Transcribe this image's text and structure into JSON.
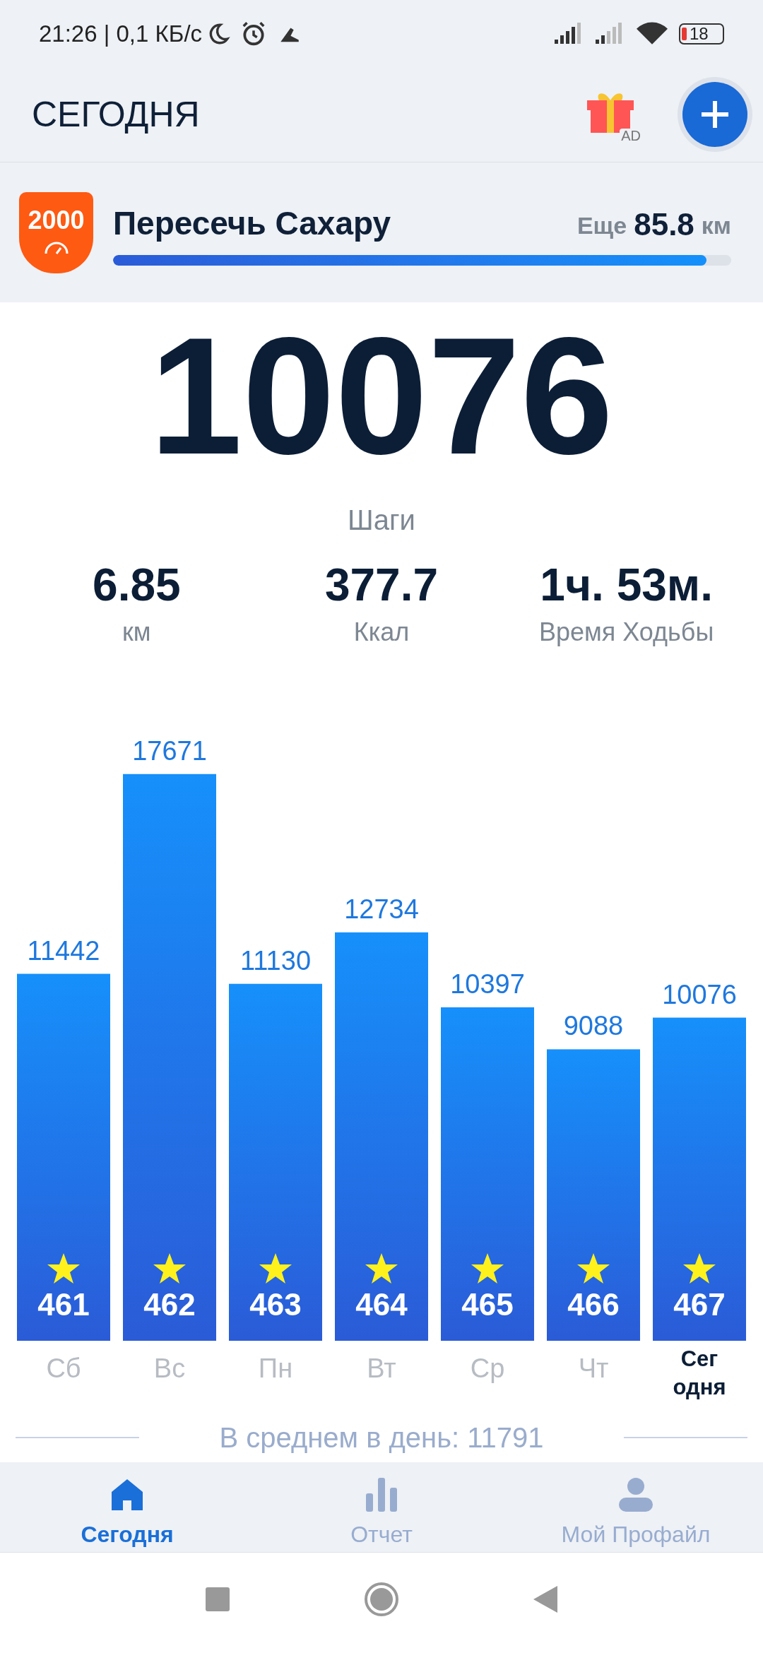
{
  "status_bar": {
    "time": "21:26 | 0,1 КБ/с",
    "battery": "18"
  },
  "header": {
    "title": "СЕГОДНЯ",
    "ad_badge": "AD"
  },
  "challenge": {
    "badge": "2000",
    "title": "Пересечь Сахару",
    "remaining_label": "Еще",
    "remaining_value": "85.8",
    "remaining_unit": "км",
    "level": 0.96
  },
  "steps": {
    "value": "10076",
    "label": "Шаги"
  },
  "stats": [
    {
      "value": "6.85",
      "label": "км"
    },
    {
      "value": "377.7",
      "label": "Ккал"
    },
    {
      "value": "1ч. 53м.",
      "label": "Время Ходьбы"
    }
  ],
  "chart": {
    "chart_data": {
      "type": "bar",
      "categories": [
        "Сб",
        "Вс",
        "Пн",
        "Вт",
        "Ср",
        "Чт",
        "Сег одня"
      ],
      "values": [
        11442,
        17671,
        11130,
        12734,
        10397,
        9088,
        10076
      ],
      "data_labels": true
    },
    "bars": [
      {
        "badge": "461",
        "selected": false
      },
      {
        "badge": "462",
        "selected": false
      },
      {
        "badge": "463",
        "selected": false
      },
      {
        "badge": "464",
        "selected": false
      },
      {
        "badge": "465",
        "selected": false
      },
      {
        "badge": "466",
        "selected": false
      },
      {
        "badge": "467",
        "selected": true
      }
    ]
  },
  "average": "В среднем в день: 11791",
  "nav": [
    {
      "kind": "home",
      "label": "Сегодня",
      "selected": true
    },
    {
      "kind": "report",
      "label": "Отчет",
      "selected": false
    },
    {
      "kind": "profile",
      "label": "Мой Профайл",
      "selected": false
    }
  ]
}
